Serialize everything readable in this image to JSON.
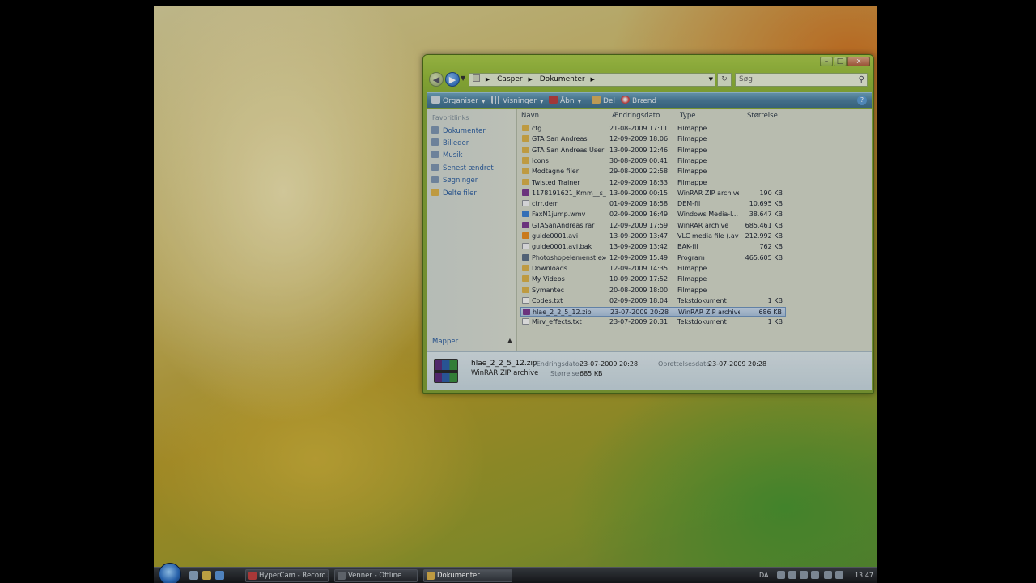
{
  "window": {
    "title_buttons": {
      "minimize": "–",
      "maximize": "□",
      "close": "x"
    },
    "address": {
      "crumbs": [
        "Casper",
        "Dokumenter"
      ]
    },
    "search_placeholder": "Søg",
    "toolbar": {
      "organiser": "Organiser",
      "visninger": "Visninger",
      "aabn": "Åbn",
      "del": "Del",
      "braend": "Brænd",
      "help": "?"
    },
    "nav": {
      "title": "Favoritlinks",
      "items": [
        "Dokumenter",
        "Billeder",
        "Musik",
        "Senest ændret",
        "Søgninger",
        "Delte filer"
      ],
      "mapper": "Mapper"
    },
    "columns": {
      "name": "Navn",
      "date": "Ændringsdato",
      "type": "Type",
      "size": "Størrelse"
    },
    "files": [
      {
        "name": "cfg",
        "date": "21-08-2009 17:11",
        "type": "Filmappe",
        "size": "",
        "icon": "folder-icon"
      },
      {
        "name": "GTA San Andreas",
        "date": "12-09-2009 18:06",
        "type": "Filmappe",
        "size": "",
        "icon": "folder-icon"
      },
      {
        "name": "GTA San Andreas User ...",
        "date": "13-09-2009 12:46",
        "type": "Filmappe",
        "size": "",
        "icon": "folder-icon"
      },
      {
        "name": "Icons!",
        "date": "30-08-2009 00:41",
        "type": "Filmappe",
        "size": "",
        "icon": "folder-icon"
      },
      {
        "name": "Modtagne filer",
        "date": "29-08-2009 22:58",
        "type": "Filmappe",
        "size": "",
        "icon": "folder-icon"
      },
      {
        "name": "Twisted Trainer",
        "date": "12-09-2009 18:33",
        "type": "Filmappe",
        "size": "",
        "icon": "folder-icon"
      },
      {
        "name": "1178191621_Kmm__s_V...",
        "date": "13-09-2009 00:15",
        "type": "WinRAR ZIP archive",
        "size": "190 KB",
        "icon": "winrar-icon"
      },
      {
        "name": "ctrr.dem",
        "date": "01-09-2009 18:58",
        "type": "DEM-fil",
        "size": "10.695 KB",
        "icon": "file-icon"
      },
      {
        "name": "FaxN1jump.wmv",
        "date": "02-09-2009 16:49",
        "type": "Windows Media-l...",
        "size": "38.647 KB",
        "icon": "media-icon"
      },
      {
        "name": "GTASanAndreas.rar",
        "date": "12-09-2009 17:59",
        "type": "WinRAR archive",
        "size": "685.461 KB",
        "icon": "winrar-icon"
      },
      {
        "name": "guide0001.avi",
        "date": "13-09-2009 13:47",
        "type": "VLC media file (.avi)",
        "size": "212.992 KB",
        "icon": "vlc-icon"
      },
      {
        "name": "guide0001.avi.bak",
        "date": "13-09-2009 13:42",
        "type": "BAK-fil",
        "size": "762 KB",
        "icon": "file-icon"
      },
      {
        "name": "Photoshopelemenst.exe",
        "date": "12-09-2009 15:49",
        "type": "Program",
        "size": "465.605 KB",
        "icon": "exe-icon"
      },
      {
        "name": "Downloads",
        "date": "12-09-2009 14:35",
        "type": "Filmappe",
        "size": "",
        "icon": "folder-icon"
      },
      {
        "name": "My Videos",
        "date": "10-09-2009 17:52",
        "type": "Filmappe",
        "size": "",
        "icon": "folder-icon"
      },
      {
        "name": "Symantec",
        "date": "20-08-2009 18:00",
        "type": "Filmappe",
        "size": "",
        "icon": "folder-icon"
      },
      {
        "name": "Codes.txt",
        "date": "02-09-2009 18:04",
        "type": "Tekstdokument",
        "size": "1 KB",
        "icon": "text-file-icon"
      },
      {
        "name": "hlae_2_2_5_12.zip",
        "date": "23-07-2009 20:28",
        "type": "WinRAR ZIP archive",
        "size": "686 KB",
        "icon": "winrar-icon",
        "selected": true
      },
      {
        "name": "Mirv_effects.txt",
        "date": "23-07-2009 20:31",
        "type": "Tekstdokument",
        "size": "1 KB",
        "icon": "text-file-icon"
      }
    ],
    "details": {
      "name": "hlae_2_2_5_12.zip",
      "type": "WinRAR ZIP archive",
      "aendring_label": "Ændringsdato:",
      "aendring_value": "23-07-2009 20:28",
      "size_label": "Størrelse:",
      "size_value": "685 KB",
      "oprettelse_label": "Oprettelsesdato:",
      "oprettelse_value": "23-07-2009 20:28"
    }
  },
  "taskbar": {
    "tasks": [
      "HyperCam - Record...",
      "Venner - Offline",
      "Dokumenter"
    ],
    "language": "DA",
    "clock": "13:47"
  },
  "colors": {
    "folder": "#d9b04a",
    "winrar": "#7a3b8f",
    "file": "#eef0f2",
    "media": "#3b7fd0",
    "vlc": "#e58a1f",
    "exe": "#5c6f86",
    "text-file": "#f4f4f4"
  }
}
